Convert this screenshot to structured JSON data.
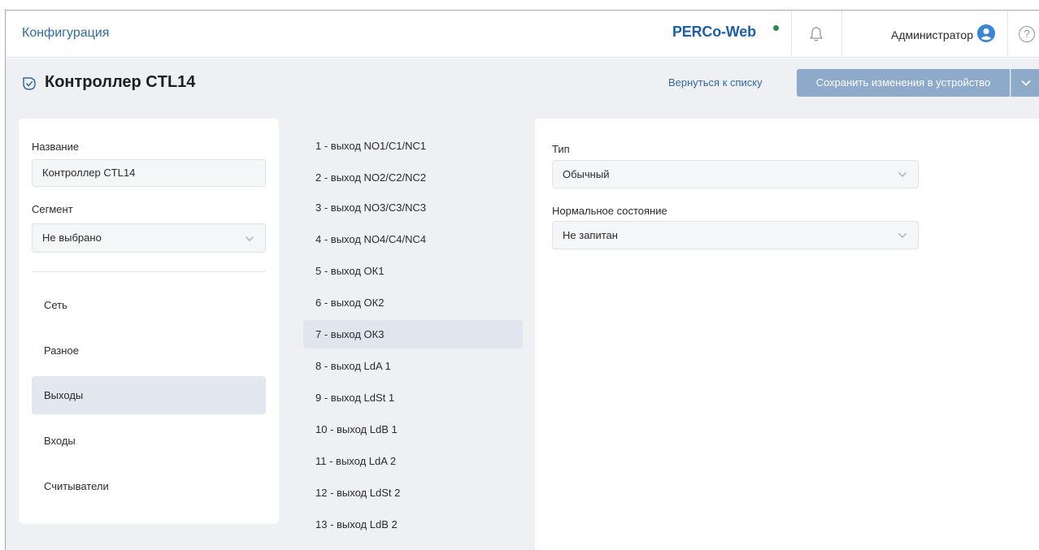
{
  "header": {
    "app_title": "Конфигурация",
    "logo": "PERCo-Web",
    "user_name": "Администратор",
    "help_symbol": "?"
  },
  "page": {
    "title": "Контроллер CTL14",
    "back_link": "Вернуться к списку",
    "save_button": "Сохранить изменения в устройство"
  },
  "form": {
    "name_label": "Название",
    "name_value": "Контроллер CTL14",
    "segment_label": "Сегмент",
    "segment_value": "Не выбрано"
  },
  "sidebar": {
    "items": [
      {
        "label": "Сеть",
        "active": false
      },
      {
        "label": "Разное",
        "active": false
      },
      {
        "label": "Выходы",
        "active": true
      },
      {
        "label": "Входы",
        "active": false
      },
      {
        "label": "Считыватели",
        "active": false
      }
    ]
  },
  "outputs": {
    "items": [
      {
        "label": "1 - выход NO1/C1/NC1",
        "active": false
      },
      {
        "label": "2 - выход NO2/C2/NC2",
        "active": false
      },
      {
        "label": "3 - выход NO3/C3/NC3",
        "active": false
      },
      {
        "label": "4 - выход NO4/C4/NC4",
        "active": false
      },
      {
        "label": "5 - выход ОК1",
        "active": false
      },
      {
        "label": "6 - выход ОК2",
        "active": false
      },
      {
        "label": "7 - выход ОК3",
        "active": true
      },
      {
        "label": "8 - выход LdA 1",
        "active": false
      },
      {
        "label": "9 - выход LdSt 1",
        "active": false
      },
      {
        "label": "10 - выход LdB 1",
        "active": false
      },
      {
        "label": "11 - выход LdA 2",
        "active": false
      },
      {
        "label": "12 - выход LdSt 2",
        "active": false
      },
      {
        "label": "13 - выход LdB 2",
        "active": false
      }
    ]
  },
  "details": {
    "type_label": "Тип",
    "type_value": "Обычный",
    "normal_state_label": "Нормальное состояние",
    "normal_state_value": "Не запитан"
  },
  "colors": {
    "accent": "#2f6aa3",
    "button": "#8eaacb",
    "active_item": "#e3e7ef",
    "status_dot": "#2e8b57"
  },
  "icons": {
    "bell": "bell-icon",
    "avatar": "user-avatar-icon",
    "help": "help-icon",
    "page": "device-check-icon",
    "dropdown": "chevron-down-icon"
  }
}
